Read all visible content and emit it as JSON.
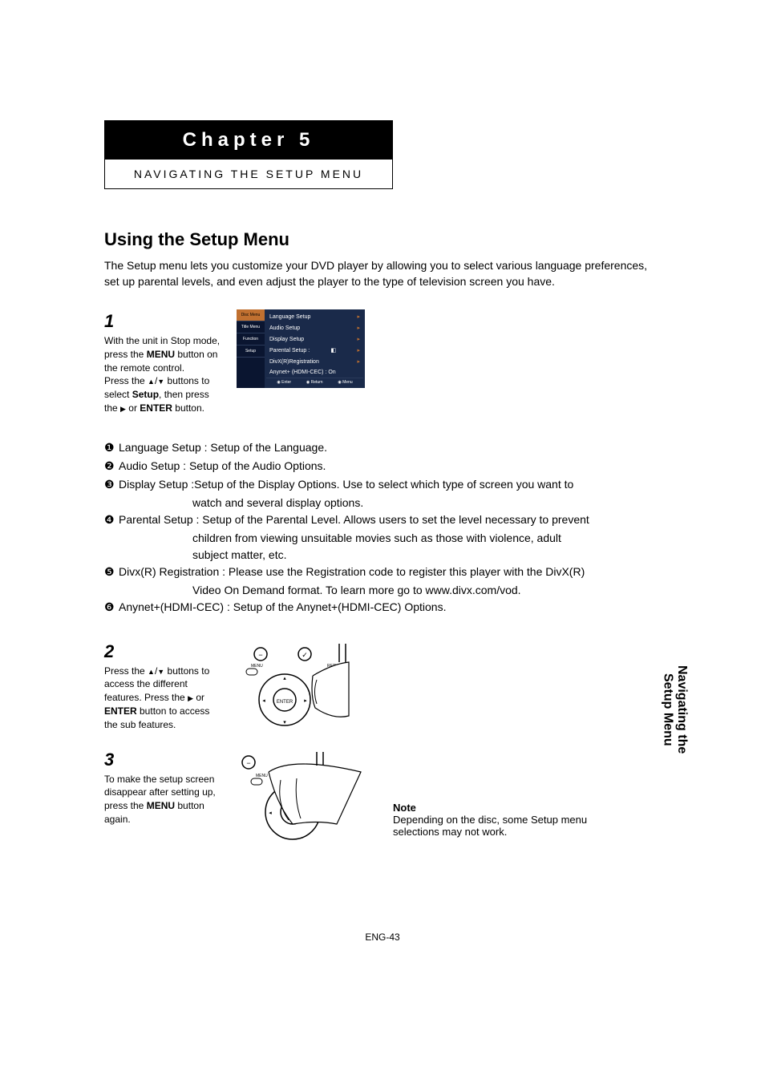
{
  "chapter": {
    "title": "Chapter 5",
    "subtitle": "NAVIGATING THE SETUP MENU"
  },
  "section_title": "Using the Setup Menu",
  "intro": "The Setup menu lets you customize your DVD player by allowing you to select various language preferences, set up parental levels, and even adjust the player to the type of television screen you have.",
  "step1": {
    "num": "1",
    "text_a": "With the unit in Stop mode, press the ",
    "menu": "MENU",
    "text_b": " button on the remote control.",
    "text_c": "Press the ",
    "text_d": " buttons to select ",
    "setup": "Setup",
    "text_e": ", then press the ",
    "text_f": " or ",
    "enter": "ENTER",
    "text_g": " button."
  },
  "menu": {
    "left": [
      "Disc Menu",
      "Title Menu",
      "Function",
      "Setup"
    ],
    "right": [
      "Language Setup",
      "Audio Setup",
      "Display Setup",
      "Parental Setup :",
      "DivX(R)Registration",
      "Anynet+ (HDMI-CEC) : On"
    ],
    "footer": [
      "Enter",
      "Return",
      "Menu"
    ]
  },
  "defs": {
    "d1": "Language Setup : Setup of the Language.",
    "d2": "Audio Setup : Setup of the Audio Options.",
    "d3": "Display Setup :Setup of the Display Options. Use to select which type of screen you want to",
    "d3b": "watch and several display options.",
    "d4": "Parental Setup : Setup of the Parental Level. Allows users to set the level necessary to prevent",
    "d4b": "children from viewing unsuitable movies such as those with violence, adult",
    "d4c": "subject matter, etc.",
    "d5": "Divx(R) Registration : Please use the Registration code to register this player with the DivX(R)",
    "d5b": "Video On Demand format. To learn more go to www.divx.com/vod.",
    "d6": "Anynet+(HDMI-CEC) : Setup of the Anynet+(HDMI-CEC) Options."
  },
  "step2": {
    "num": "2",
    "text_a": "Press the ",
    "text_b": " buttons to access the different features. Press the ",
    "text_c": " or ",
    "enter": "ENTER",
    "text_d": " button to access the sub features."
  },
  "step3": {
    "num": "3",
    "text_a": "To make the setup screen disappear after setting up, press the ",
    "menu": "MENU",
    "text_b": " button again."
  },
  "note": {
    "title": "Note",
    "body": "Depending on the disc, some Setup menu selections may not work."
  },
  "side_tab": "Navigating the\nSetup Menu",
  "pagenum": "ENG-43"
}
